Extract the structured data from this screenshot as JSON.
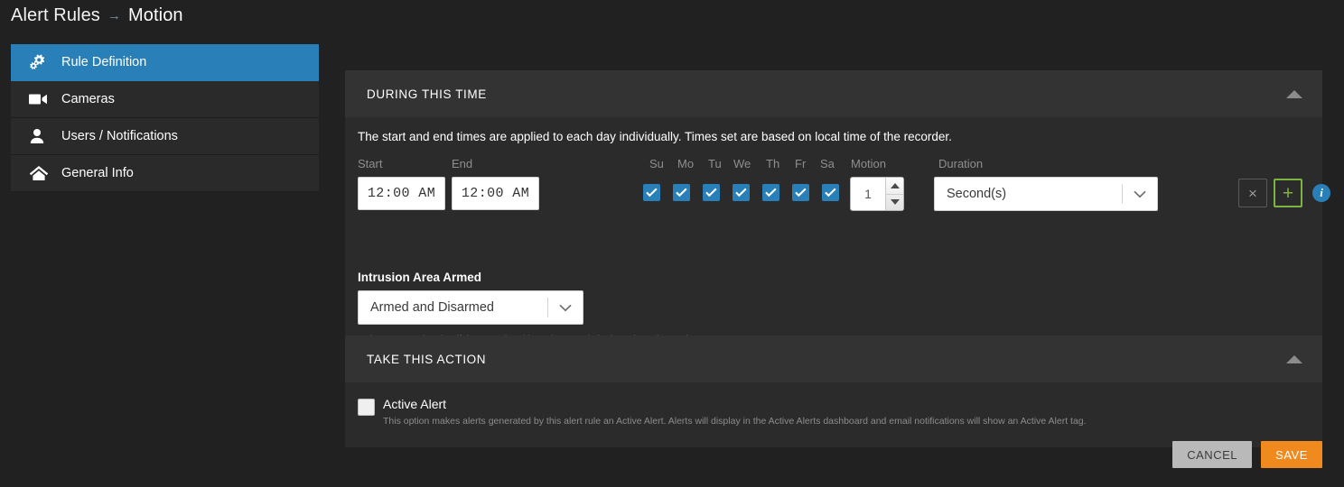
{
  "breadcrumb": {
    "root": "Alert Rules",
    "separator": "→",
    "leaf": "Motion"
  },
  "sidebar": {
    "items": [
      {
        "label": "Rule Definition",
        "icon": "gears-icon",
        "active": true
      },
      {
        "label": "Cameras",
        "icon": "camera-icon",
        "active": false
      },
      {
        "label": "Users / Notifications",
        "icon": "user-icon",
        "active": false
      },
      {
        "label": "General Info",
        "icon": "home-icon",
        "active": false
      }
    ]
  },
  "during_panel": {
    "title": "DURING THIS TIME",
    "collapse_icon": "chevron-up-icon",
    "helper_text": "The start and end times are applied to each day individually. Times set are based on local time of the recorder.",
    "columns": {
      "start": "Start",
      "end": "End",
      "motion": "Motion",
      "duration": "Duration"
    },
    "days": [
      "Su",
      "Mo",
      "Tu",
      "We",
      "Th",
      "Fr",
      "Sa"
    ],
    "days_checked": [
      true,
      true,
      true,
      true,
      true,
      true,
      true
    ],
    "start_time": "12:00 AM",
    "end_time": "12:00 AM",
    "motion_count": "1",
    "duration_unit": "Second(s)",
    "remove_button": "×",
    "add_button": "+",
    "info_button": "i",
    "intrusion_label": "Intrusion Area Armed",
    "intrusion_value": "Armed and Disarmed",
    "intrusion_help": "Only generate the alert if the associated intrusion area is in the selected armed state."
  },
  "action_panel": {
    "title": "TAKE THIS ACTION",
    "collapse_icon": "chevron-up-icon",
    "active_alert_label": "Active Alert",
    "active_alert_checked": false,
    "active_alert_help": "This option makes alerts generated by this alert rule an Active Alert. Alerts will display in the Active Alerts dashboard and email notifications will show an Active Alert tag."
  },
  "footer": {
    "cancel_label": "CANCEL",
    "save_label": "SAVE"
  },
  "colors": {
    "page_bg": "#212121",
    "panel_head_bg": "#333333",
    "panel_body_bg": "#2b2b2b",
    "accent_blue": "#2980b9",
    "add_green": "#7cb342",
    "save_orange": "#f08a1e",
    "cancel_gray": "#b9b9b9"
  }
}
